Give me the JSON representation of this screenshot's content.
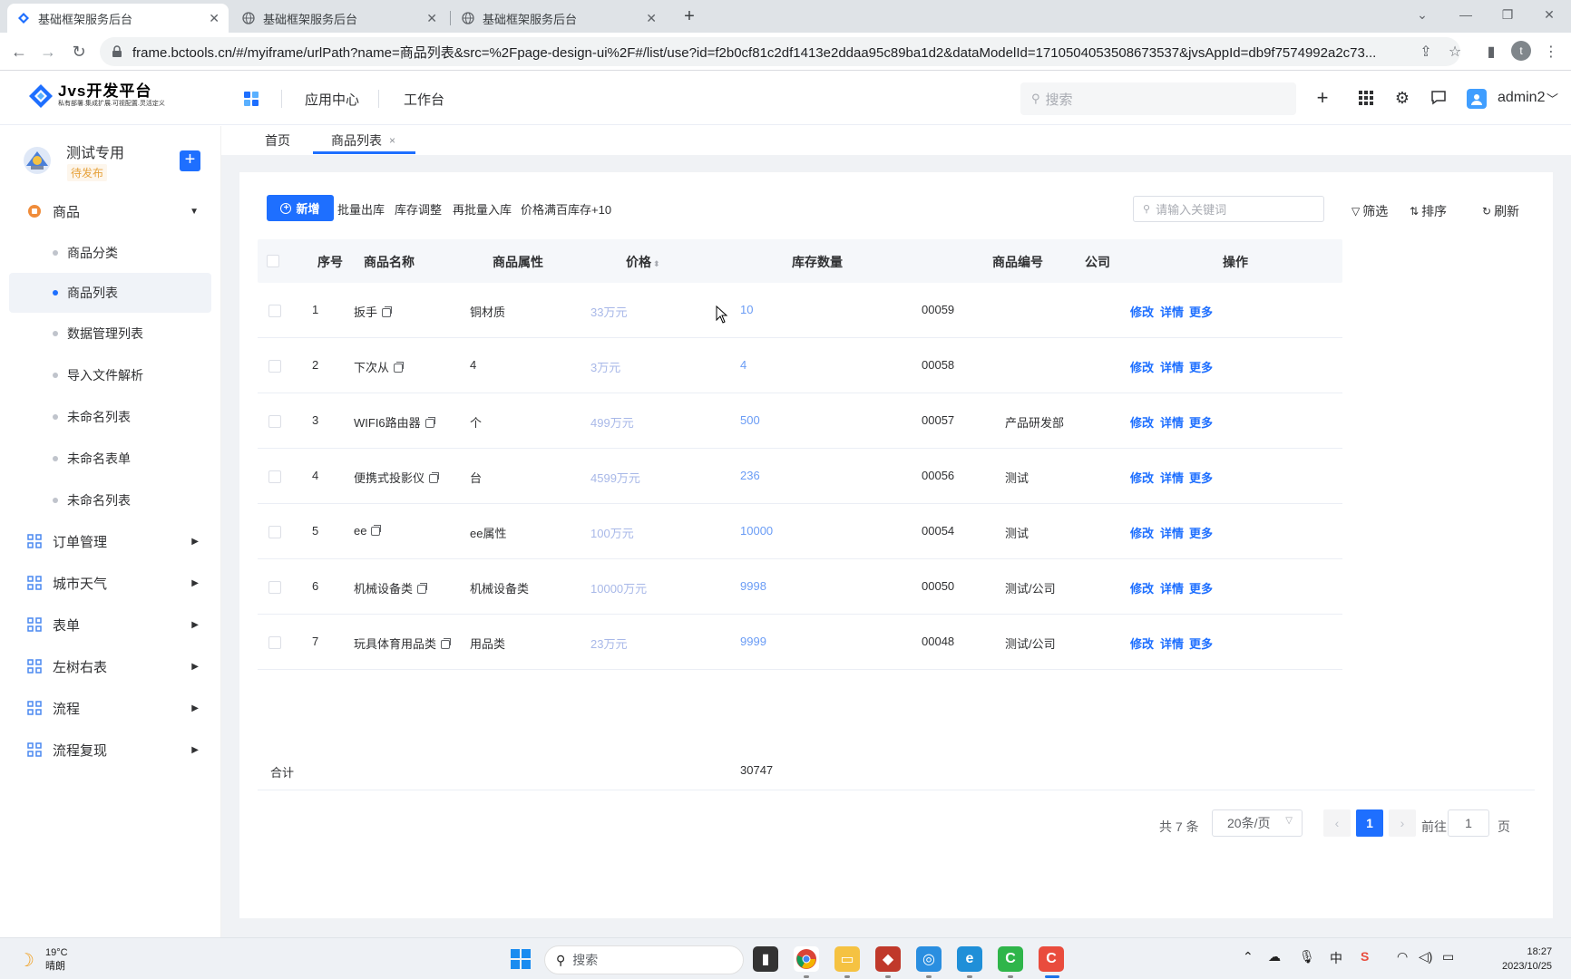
{
  "browser": {
    "tabs": [
      {
        "title": "基础框架服务后台",
        "active": true
      },
      {
        "title": "基础框架服务后台",
        "active": false
      },
      {
        "title": "基础框架服务后台",
        "active": false
      }
    ],
    "url": "frame.bctools.cn/#/myiframe/urlPath?name=商品列表&src=%2Fpage-design-ui%2F#/list/use?id=f2b0cf81c2df1413e2ddaa95c89ba1d2&dataModelId=1710504053508673537&jvsAppId=db9f7574992a2c73...",
    "profile_initial": "t"
  },
  "header": {
    "logo_title": "Jvs开发平台",
    "logo_subtitle": "私有部署.集成扩展.可视配置.灵活定义",
    "nav": [
      "应用中心",
      "工作台"
    ],
    "search_placeholder": "搜索",
    "username": "admin2"
  },
  "sidebar": {
    "project_name": "测试专用",
    "project_status": "待发布",
    "menu": [
      {
        "label": "商品",
        "expanded": true,
        "children": [
          "商品分类",
          "商品列表",
          "数据管理列表",
          "导入文件解析",
          "未命名列表",
          "未命名表单",
          "未命名列表"
        ],
        "active_child": 1
      },
      {
        "label": "订单管理",
        "expanded": false
      },
      {
        "label": "城市天气",
        "expanded": false
      },
      {
        "label": "表单",
        "expanded": false
      },
      {
        "label": "左树右表",
        "expanded": false
      },
      {
        "label": "流程",
        "expanded": false
      },
      {
        "label": "流程复现",
        "expanded": false
      }
    ]
  },
  "page_tabs": [
    {
      "label": "首页",
      "active": false
    },
    {
      "label": "商品列表",
      "active": true
    }
  ],
  "toolbar": {
    "add_label": "新增",
    "buttons": [
      "批量出库",
      "库存调整",
      "再批量入库",
      "价格满百库存+10"
    ],
    "keyword_placeholder": "请输入关键词",
    "filter_label": "筛选",
    "sort_label": "排序",
    "refresh_label": "刷新"
  },
  "table": {
    "headers": [
      "序号",
      "商品名称",
      "商品属性",
      "价格",
      "库存数量",
      "商品编号",
      "公司",
      "操作"
    ],
    "rows": [
      {
        "no": "1",
        "name": "扳手",
        "attr": "铜材质",
        "price": "33万元",
        "stock": "10",
        "code": "00059",
        "company": ""
      },
      {
        "no": "2",
        "name": "下次从",
        "attr": "4",
        "price": "3万元",
        "stock": "4",
        "code": "00058",
        "company": ""
      },
      {
        "no": "3",
        "name": "WIFI6路由器",
        "attr": "个",
        "price": "499万元",
        "stock": "500",
        "code": "00057",
        "company": "产品研发部"
      },
      {
        "no": "4",
        "name": "便携式投影仪",
        "attr": "台",
        "price": "4599万元",
        "stock": "236",
        "code": "00056",
        "company": "测试"
      },
      {
        "no": "5",
        "name": "ee",
        "attr": "ee属性",
        "price": "100万元",
        "stock": "10000",
        "code": "00054",
        "company": "测试"
      },
      {
        "no": "6",
        "name": "机械设备类",
        "attr": "机械设备类",
        "price": "10000万元",
        "stock": "9998",
        "code": "00050",
        "company": "测试/公司"
      },
      {
        "no": "7",
        "name": "玩具体育用品类",
        "attr": "用品类",
        "price": "23万元",
        "stock": "9999",
        "code": "00048",
        "company": "测试/公司"
      }
    ],
    "actions": [
      "修改",
      "详情",
      "更多"
    ],
    "summary_label": "合计",
    "summary_stock": "30747"
  },
  "pager": {
    "total": "共 7 条",
    "page_size": "20条/页",
    "current": "1",
    "goto_label": "前往",
    "goto_value": "1",
    "goto_unit": "页"
  },
  "taskbar": {
    "temperature": "19°C",
    "weather": "晴朗",
    "search_label": "搜索",
    "tray_lang": "中",
    "time": "18:27",
    "date": "2023/10/25"
  },
  "colors": {
    "primary": "#1e6fff",
    "price_text": "#a8b8e8",
    "stock_text": "#6a9cf5",
    "status_warning": "#e6a23c"
  }
}
